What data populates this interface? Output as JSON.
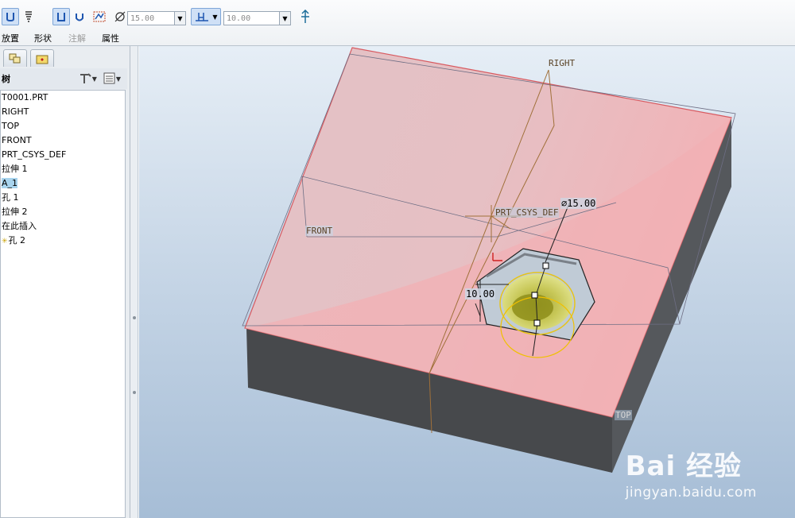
{
  "dashboard": {
    "diameter_value": "15.00",
    "depth_value": "10.00",
    "panel_tabs": [
      "放置",
      "形状",
      "注解",
      "属性"
    ]
  },
  "navigator": {
    "tree_title": "树",
    "items": [
      {
        "label": "T0001.PRT"
      },
      {
        "label": "RIGHT"
      },
      {
        "label": "TOP"
      },
      {
        "label": "FRONT"
      },
      {
        "label": "PRT_CSYS_DEF"
      },
      {
        "label": "拉伸 1"
      },
      {
        "label": "A_1",
        "selected": true
      },
      {
        "label": "孔 1"
      },
      {
        "label": "拉伸 2"
      },
      {
        "label": "在此插入"
      },
      {
        "label": "孔 2",
        "insert_marker": true
      }
    ]
  },
  "graphics": {
    "datum_labels": {
      "right": "RIGHT",
      "front": "FRONT",
      "top": "TOP",
      "csys": "PRT_CSYS_DEF"
    },
    "dimension_diameter": "15.00",
    "dimension_depth": "10.00",
    "colors": {
      "top_face": "#f2b8bc",
      "side_face": "#4a4e52",
      "hole_fill": "#d8d84a",
      "datum_line": "#a0703a"
    }
  },
  "watermark": {
    "brand": "Bai  经验",
    "url": "jingyan.baidu.com"
  }
}
